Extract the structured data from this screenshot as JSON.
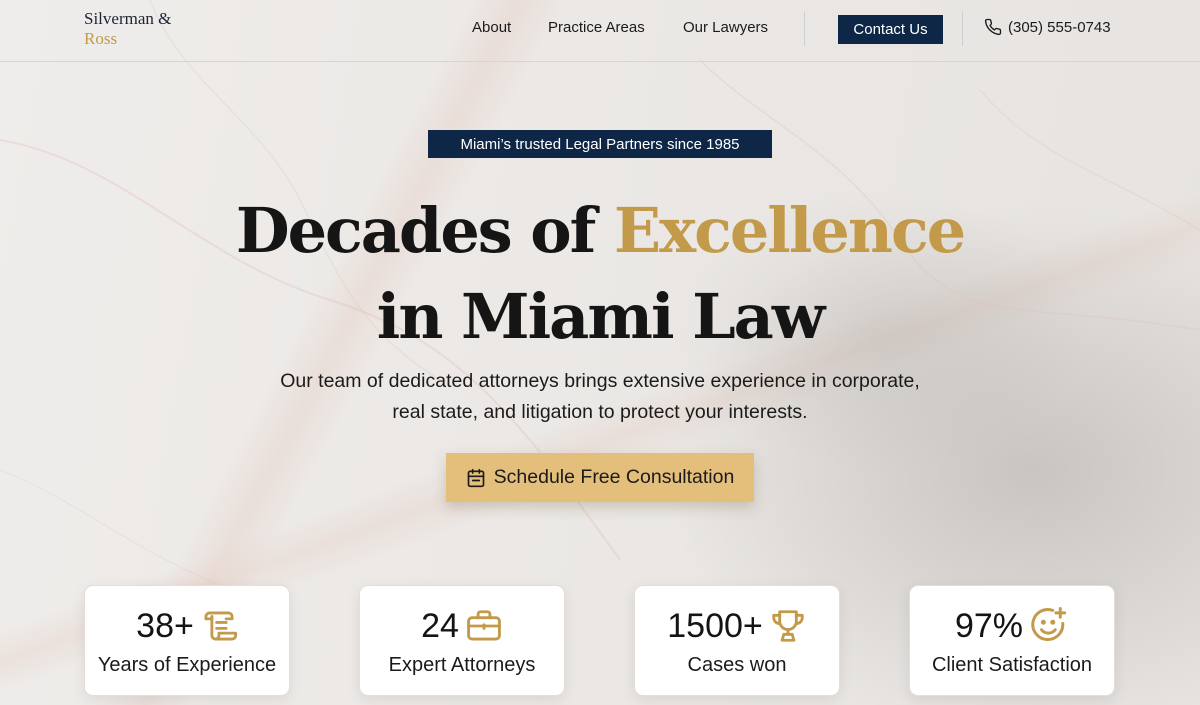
{
  "header": {
    "logo_line1": "Silverman &",
    "logo_line2": "Ross",
    "nav": [
      {
        "label": "About"
      },
      {
        "label": "Practice Areas"
      },
      {
        "label": "Our Lawyers"
      }
    ],
    "contact_label": "Contact Us",
    "phone": "(305) 555-0743"
  },
  "hero": {
    "badge": "Miami’s trusted Legal Partners since 1985",
    "headline_part1": "Decades of ",
    "headline_highlight": "Excellence",
    "headline_line2": "in Miami Law",
    "subtext_line1": "Our team of dedicated attorneys brings extensive experience in corporate,",
    "subtext_line2": "real state, and litigation to protect your interests.",
    "cta_label": "Schedule Free Consultation"
  },
  "stats": [
    {
      "value": "38+",
      "label": "Years of Experience",
      "icon": "scroll-icon"
    },
    {
      "value": "24",
      "label": "Expert Attorneys",
      "icon": "briefcase-icon"
    },
    {
      "value": "1500+",
      "label": "Cases won",
      "icon": "trophy-icon"
    },
    {
      "value": "97%",
      "label": "Client Satisfaction",
      "icon": "smile-plus-icon"
    }
  ],
  "colors": {
    "navy": "#0e2747",
    "gold": "#c29a4a",
    "cta_gold": "#e4be7b"
  }
}
